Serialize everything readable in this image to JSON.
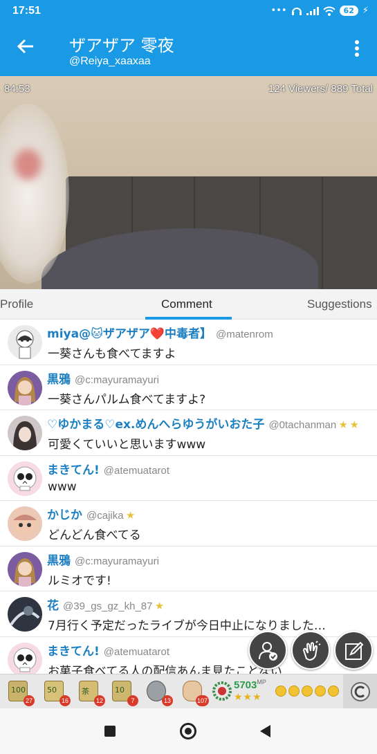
{
  "status": {
    "time": "17:51",
    "battery": "62"
  },
  "header": {
    "title": "ザアザア 零夜",
    "subtitle": "@Reiya_xaaxaa"
  },
  "video": {
    "elapsed": "84:53",
    "viewers": "124 Viewers/ 889 Total"
  },
  "tabs": [
    {
      "label": "Profile"
    },
    {
      "label": "Comment"
    },
    {
      "label": "Suggestions"
    }
  ],
  "comments": [
    {
      "name": "miya@🐱ザアザア❤️中毒者】",
      "handle": "@matenrom",
      "text": "一葵さんも食べてますよ",
      "avatar_color": "#e8e8e8"
    },
    {
      "name": "黒鴉",
      "handle": "@c:mayuramayuri",
      "text": "一葵さんパルム食べてますよ?",
      "avatar_color": "#c8a46a"
    },
    {
      "name": "♡ゆかまる♡ex.めんへらゆうがいおた子",
      "handle": "@0tachanman",
      "text": "可愛くていいと思いますwww",
      "avatar_color": "#b9aeb0"
    },
    {
      "name": "まきてん!",
      "handle": "@atemuatarot",
      "text": "www",
      "avatar_color": "#f2c9d3"
    },
    {
      "name": "かじか",
      "handle": "@cajika",
      "text": "どんどん食べてる",
      "avatar_color": "#e2b0a0"
    },
    {
      "name": "黒鴉",
      "handle": "@c:mayuramayuri",
      "text": "ルミオです!",
      "avatar_color": "#c8a46a"
    },
    {
      "name": "花",
      "handle": "@39_gs_gz_kh_87",
      "text": "7月行く予定だったライブが今日中止になりました…",
      "avatar_color": "#2e3540"
    },
    {
      "name": "まきてん!",
      "handle": "@atemuatarot",
      "text": "お菓子食べてる人の配信あんま見たことない",
      "avatar_color": "#f2c9d3"
    }
  ],
  "gifts": [
    {
      "label": "100",
      "count": "27"
    },
    {
      "label": "50",
      "count": "16"
    },
    {
      "label": "茶",
      "count": "12"
    },
    {
      "label": "10",
      "count": "7"
    },
    {
      "label": "",
      "count": "13"
    },
    {
      "label": "",
      "count": "107"
    }
  ],
  "points": {
    "value": "5703",
    "unit": "MP",
    "stars": "★★★"
  },
  "colors": {
    "accent": "#1a9ae4",
    "name": "#1b7fc2"
  }
}
